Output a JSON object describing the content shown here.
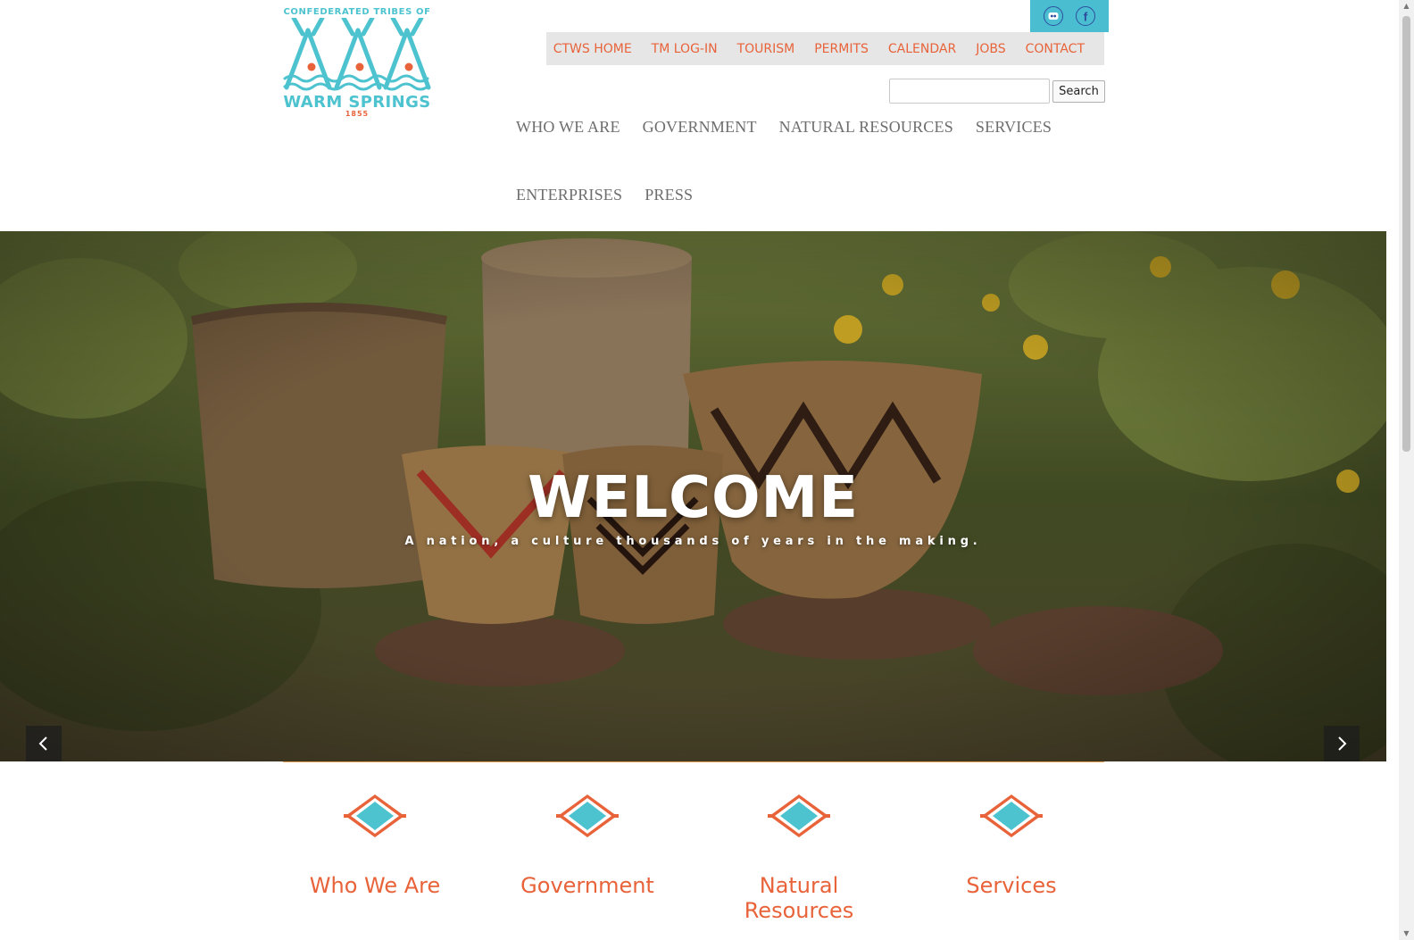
{
  "logo": {
    "top_line": "CONFEDERATED TRIBES OF",
    "name": "WARM SPRINGS",
    "year": "1855"
  },
  "social": [
    {
      "icon": "flickr-icon"
    },
    {
      "icon": "facebook-icon",
      "glyph": "f"
    }
  ],
  "top_nav": [
    "CTWS HOME",
    "TM LOG-IN",
    "TOURISM",
    "PERMITS",
    "CALENDAR",
    "JOBS",
    "CONTACT"
  ],
  "search": {
    "placeholder": "",
    "button_label": "Search"
  },
  "main_nav": {
    "row1": [
      "WHO WE ARE",
      "GOVERNMENT",
      "NATURAL RESOURCES",
      "SERVICES"
    ],
    "row2": [
      "ENTERPRISES",
      "PRESS"
    ]
  },
  "hero": {
    "title": "WELCOME",
    "subtitle": "A nation, a culture thousands of years in the making.",
    "prev_icon": "chevron-left-icon",
    "next_icon": "chevron-right-icon"
  },
  "features": [
    {
      "label": "Who We Are",
      "icon": "diamond-emblem-icon"
    },
    {
      "label": "Government",
      "icon": "diamond-emblem-icon"
    },
    {
      "label": "Natural Resources",
      "icon": "diamond-emblem-icon"
    },
    {
      "label": "Services",
      "icon": "diamond-emblem-icon"
    }
  ],
  "colors": {
    "accent_orange": "#e8633a",
    "accent_teal": "#4dc3cf",
    "social_bar": "#4bbdd1",
    "top_nav_bg": "#e6e6e6",
    "main_nav_text": "#6e6e6e",
    "divider": "#e8a55a"
  }
}
